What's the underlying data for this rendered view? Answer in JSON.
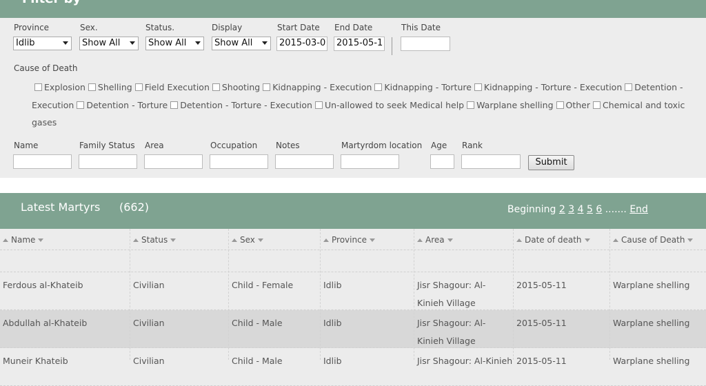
{
  "filter": {
    "title": "Filter by",
    "province": {
      "label": "Province",
      "value": "Idlib"
    },
    "sex": {
      "label": "Sex.",
      "value": "Show All"
    },
    "status": {
      "label": "Status.",
      "value": "Show All"
    },
    "display": {
      "label": "Display",
      "value": "Show All"
    },
    "start_date": {
      "label": "Start Date",
      "value": "2015-03-0"
    },
    "end_date": {
      "label": "End Date",
      "value": "2015-05-1"
    },
    "this_date": {
      "label": "This Date",
      "value": ""
    },
    "cause_label": "Cause of Death",
    "causes": [
      "Explosion",
      "Shelling",
      "Field Execution",
      "Shooting",
      "Kidnapping - Execution",
      "Kidnapping - Torture",
      "Kidnapping - Torture - Execution",
      "Detention - Execution",
      "Detention - Torture",
      "Detention - Torture - Execution",
      "Un-allowed to seek Medical help",
      "Warplane shelling",
      "Other",
      "Chemical and toxic gases"
    ],
    "text_fields": {
      "name": "Name",
      "family_status": "Family Status",
      "area": "Area",
      "occupation": "Occupation",
      "notes": "Notes",
      "martyrdom_location": "Martyrdom location",
      "age": "Age",
      "rank": "Rank"
    },
    "submit_label": "Submit"
  },
  "results": {
    "title": "Latest Martyrs",
    "count": "(662)",
    "pager": {
      "beginning": "Beginning",
      "pages": [
        "2",
        "3",
        "4",
        "5",
        "6"
      ],
      "dots": ".......",
      "end": "End"
    },
    "columns": [
      "Name",
      "Status",
      "Sex",
      "Province",
      "Area",
      "Date of death",
      "Cause of Death"
    ],
    "rows": [
      {
        "name": "Ferdous al-Khateib",
        "status": "Civilian",
        "sex": "Child - Female",
        "province": "Idlib",
        "area": "Jisr Shagour: Al-Kinieh Village",
        "date": "2015-05-11",
        "cause": "Warplane shelling"
      },
      {
        "name": "Abdullah al-Khateib",
        "status": "Civilian",
        "sex": "Child - Male",
        "province": "Idlib",
        "area": "Jisr Shagour: Al-Kinieh Village",
        "date": "2015-05-11",
        "cause": "Warplane shelling"
      },
      {
        "name": "Muneir Khateib",
        "status": "Civilian",
        "sex": "Child - Male",
        "province": "Idlib",
        "area": "Jisr Shagour: Al-Kinieh",
        "date": "2015-05-11",
        "cause": "Warplane shelling"
      }
    ]
  },
  "colors": {
    "header": "#7fa391",
    "panel": "#ededed",
    "row_alt": "#d8d8d8"
  }
}
